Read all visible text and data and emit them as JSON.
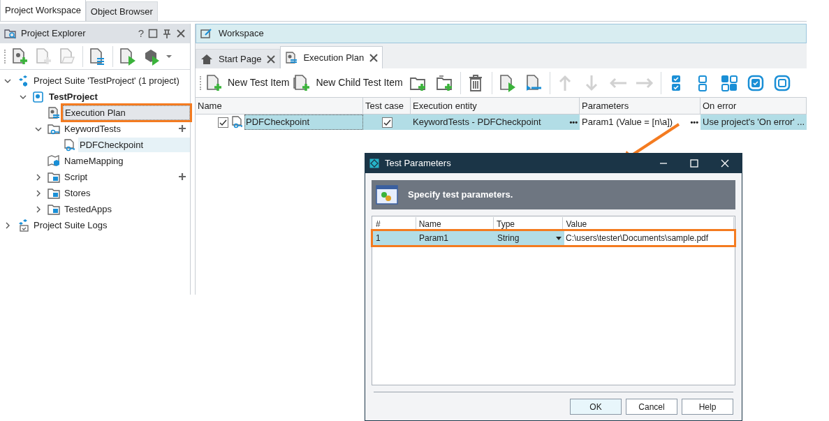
{
  "top_tabs": [
    {
      "label": "Project Workspace",
      "selected": true
    },
    {
      "label": "Object Browser",
      "selected": false
    }
  ],
  "explorer": {
    "title": "Project Explorer",
    "help_mark": "?",
    "toolbar": [
      {
        "kind": "add-project",
        "disabled": false
      },
      {
        "kind": "new-file",
        "disabled": true
      },
      {
        "kind": "open-file",
        "disabled": true
      },
      {
        "kind": "plan",
        "disabled": false
      },
      {
        "kind": "run",
        "disabled": false
      },
      {
        "kind": "run-suite",
        "disabled": false
      }
    ],
    "tree": [
      {
        "label": "Project Suite 'TestProject' (1 project)",
        "kind": "suite",
        "expanded": true,
        "selected": false,
        "hovered": false,
        "children": [
          {
            "label": "TestProject",
            "kind": "project",
            "bold": true,
            "expanded": true,
            "selected": false,
            "hovered": false,
            "children": [
              {
                "label": "Execution Plan",
                "kind": "plan",
                "selected": true,
                "hovered": false,
                "highlighted": true
              },
              {
                "label": "KeywordTests",
                "kind": "keyword-folder",
                "expanded": true,
                "selected": false,
                "hovered": false,
                "addable": true,
                "children": [
                  {
                    "label": "PDFCheckpoint",
                    "kind": "keyword-test",
                    "selected": false,
                    "hovered": true
                  }
                ]
              },
              {
                "label": "NameMapping",
                "kind": "mapping",
                "selected": false,
                "hovered": false
              },
              {
                "label": "Script",
                "kind": "folder",
                "expanded": false,
                "selected": false,
                "hovered": false,
                "addable": true
              },
              {
                "label": "Stores",
                "kind": "folder",
                "expanded": false,
                "selected": false,
                "hovered": false
              },
              {
                "label": "TestedApps",
                "kind": "folder",
                "expanded": false,
                "selected": false,
                "hovered": false
              }
            ]
          }
        ]
      },
      {
        "label": "Project Suite Logs",
        "kind": "logs",
        "expanded": false,
        "selected": false,
        "hovered": false
      }
    ]
  },
  "workspace": {
    "title": "Workspace",
    "tabs": [
      {
        "label": "Start Page",
        "kind": "home",
        "selected": false
      },
      {
        "label": "Execution Plan",
        "kind": "plan",
        "selected": true
      }
    ],
    "toolbar": [
      {
        "kind": "new-item",
        "label": "New Test Item",
        "disabled": false
      },
      {
        "kind": "new-child",
        "label": "New Child Test Item",
        "disabled": false
      },
      {
        "kind": "add-folder",
        "disabled": false
      },
      {
        "kind": "add-child-folder",
        "disabled": false
      },
      {
        "kind": "delete",
        "disabled": false
      },
      {
        "kind": "run",
        "disabled": false
      },
      {
        "kind": "run-selected",
        "disabled": false
      },
      {
        "kind": "up",
        "disabled": true
      },
      {
        "kind": "down",
        "disabled": true
      },
      {
        "kind": "left",
        "disabled": true
      },
      {
        "kind": "right",
        "disabled": true
      },
      {
        "kind": "check-all",
        "disabled": false
      },
      {
        "kind": "uncheck-all",
        "disabled": false
      },
      {
        "kind": "check-mixed",
        "disabled": false
      },
      {
        "kind": "check-one",
        "disabled": false
      },
      {
        "kind": "uncheck-one",
        "disabled": false
      }
    ],
    "columns": [
      "Name",
      "Test case",
      "Execution entity",
      "Parameters",
      "On error"
    ],
    "rows": [
      {
        "name": "PDFCheckpoint",
        "enabled": true,
        "test_case": true,
        "entity": "KeywordTests - PDFCheckpoint",
        "entity_more": "•••",
        "parameters": "Param1 (Value = [n\\a])",
        "parameters_more": "•••",
        "on_error": "Use project's 'On error' ...",
        "selected": true
      }
    ]
  },
  "dialog": {
    "title": "Test Parameters",
    "banner": "Specify test parameters.",
    "columns": [
      "#",
      "Name",
      "Type",
      "Value"
    ],
    "rows": [
      {
        "index": "1",
        "name": "Param1",
        "type": "String",
        "value": "C:\\users\\tester\\Documents\\sample.pdf",
        "selected": true,
        "highlighted": true
      }
    ],
    "buttons": [
      {
        "label": "OK",
        "default": true
      },
      {
        "label": "Cancel",
        "default": false
      },
      {
        "label": "Help",
        "default": false
      }
    ]
  }
}
